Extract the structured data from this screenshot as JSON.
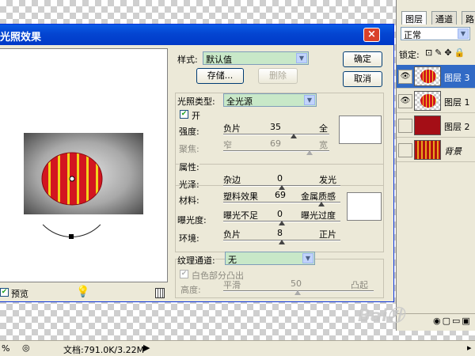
{
  "dialog": {
    "title": "光照效果",
    "close_label": "×",
    "ok_label": "确定",
    "cancel_label": "取消",
    "preview_label": "预览",
    "style": {
      "label": "样式:",
      "value": "默认值",
      "save_label": "存储...",
      "delete_label": "删除"
    },
    "light_type": {
      "label": "光照类型:",
      "value": "全光源",
      "on_label": "开",
      "intensity_label": "强度:",
      "intensity_min": "负片",
      "intensity_value": "35",
      "intensity_max": "全",
      "focus_label": "聚焦:",
      "focus_min": "窄",
      "focus_value": "69",
      "focus_max": "宽"
    },
    "properties": {
      "section_label": "属性:",
      "gloss_label": "光泽:",
      "gloss_min": "杂边",
      "gloss_value": "0",
      "gloss_max": "发光",
      "material_label": "材料:",
      "material_min": "塑料效果",
      "material_value": "69",
      "material_max": "金属质感",
      "exposure_label": "曝光度:",
      "exposure_min": "曝光不足",
      "exposure_value": "0",
      "exposure_max": "曝光过度",
      "ambience_label": "环境:",
      "ambience_min": "负片",
      "ambience_value": "8",
      "ambience_max": "正片"
    },
    "texture": {
      "label": "纹理通道:",
      "value": "无",
      "white_high_label": "白色部分凸出",
      "height_label": "高度:",
      "height_min": "平滑",
      "height_value": "50",
      "height_max": "凸起"
    }
  },
  "layers_panel": {
    "tabs": [
      "图层",
      "通道",
      "路"
    ],
    "blend_mode": "正常",
    "lock_label": "锁定:",
    "layers": [
      {
        "name": "图层 3",
        "visible": true,
        "selected": true
      },
      {
        "name": "图层 1",
        "visible": true,
        "selected": false
      },
      {
        "name": "图层 2",
        "visible": false,
        "selected": false
      },
      {
        "name": "背景",
        "visible": false,
        "selected": false
      }
    ]
  },
  "status_bar": {
    "zoom": "%",
    "doc_info": "文档:791.0K/3.22M"
  },
  "colors": {
    "title_bar": "#0445d1",
    "selected_layer": "#316ac5",
    "lantern_red": "#d31520",
    "lantern_yellow": "#f2d21b"
  }
}
